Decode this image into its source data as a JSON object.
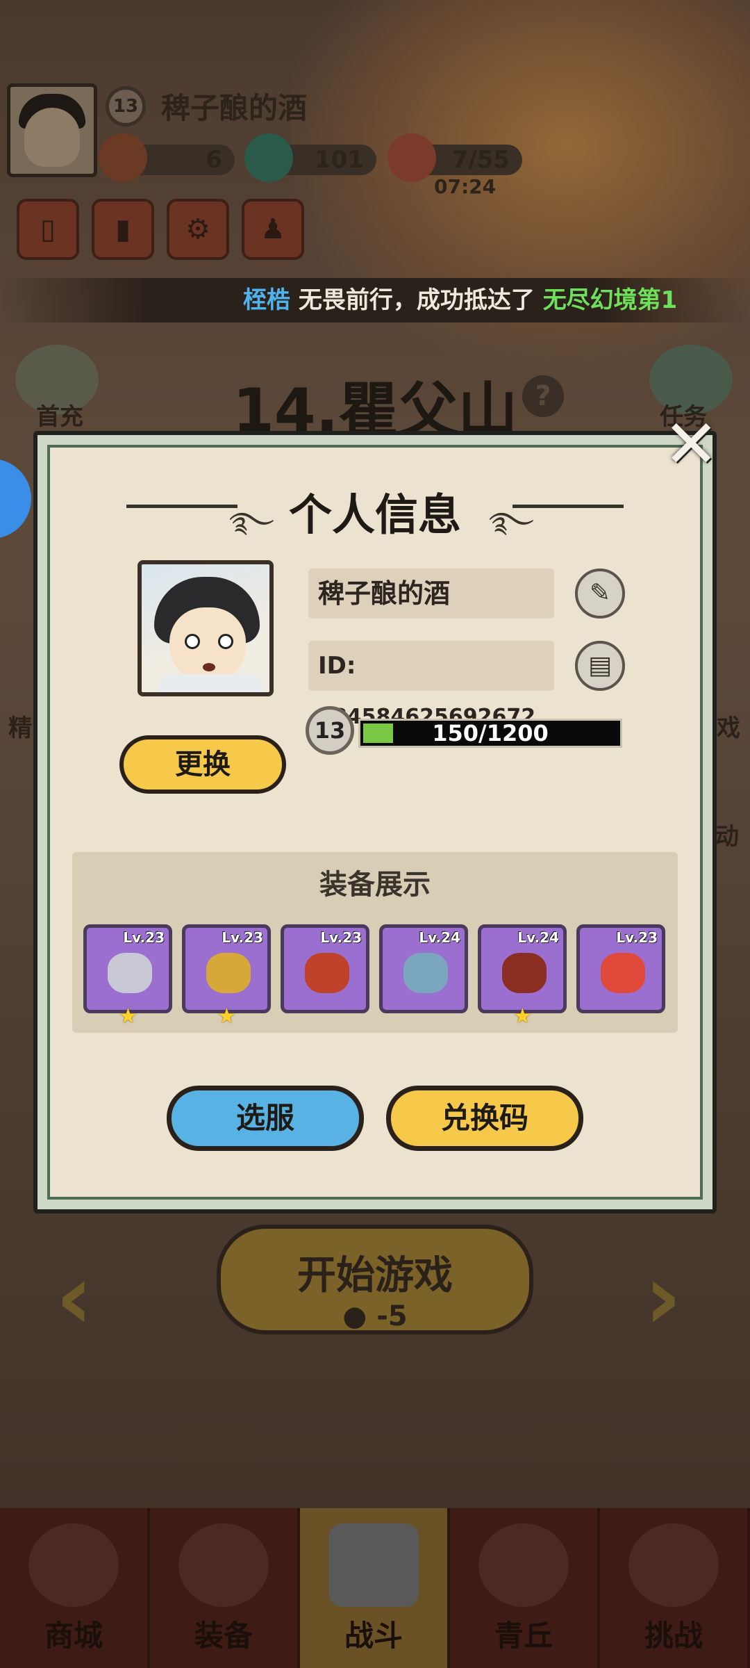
{
  "top": {
    "level": "13",
    "player_name": "稗子酿的酒",
    "resources": [
      {
        "name": "scroll-resource",
        "value": "6"
      },
      {
        "name": "dragon-resource",
        "value": "101"
      },
      {
        "name": "peach-stamina",
        "value": "7/55"
      }
    ],
    "stamina_timer": "07:24"
  },
  "banner": {
    "player": "桎梏",
    "text": " 无畏前行，成功抵达了 ",
    "place": "无尽幻境第1"
  },
  "stage": {
    "title": "14.瞿父山",
    "help": "?"
  },
  "side": {
    "first_charge": "首充",
    "task": "任务",
    "left_partial": "精",
    "right_partial_1": "戏",
    "right_partial_2": "动"
  },
  "start": {
    "label": "开始游戏",
    "cost": "-5"
  },
  "modal": {
    "title": "个人信息",
    "close": "✕",
    "name": "稗子酿的酒",
    "id_label": "ID:",
    "id_value": "384584625692672",
    "level": "13",
    "xp_text": "150/1200",
    "xp_fraction": 0.125,
    "change_label": "更换",
    "equip_header": "装备展示",
    "equipment": [
      {
        "level": "Lv.23",
        "star": true,
        "color": "#c9c9d6"
      },
      {
        "level": "Lv.23",
        "star": true,
        "color": "#d6a83a"
      },
      {
        "level": "Lv.23",
        "star": false,
        "color": "#c0412a"
      },
      {
        "level": "Lv.24",
        "star": false,
        "color": "#7aa6c0"
      },
      {
        "level": "Lv.24",
        "star": true,
        "color": "#8a2e22"
      },
      {
        "level": "Lv.23",
        "star": false,
        "color": "#e04a3a"
      }
    ],
    "select_server": "选服",
    "redeem_code": "兑换码"
  },
  "nav": [
    {
      "label": "商城",
      "active": false
    },
    {
      "label": "装备",
      "active": false
    },
    {
      "label": "战斗",
      "active": true
    },
    {
      "label": "青丘",
      "active": false
    },
    {
      "label": "挑战",
      "active": false
    }
  ]
}
